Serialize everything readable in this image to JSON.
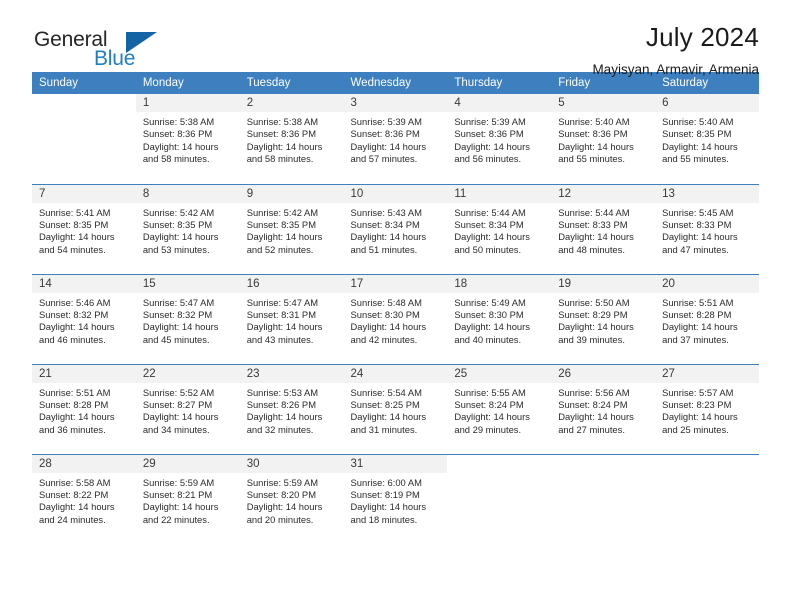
{
  "brand": {
    "name_top": "General",
    "name_bottom": "Blue",
    "triangle_color": "#1464a5",
    "blue_color": "#1f7fc4"
  },
  "header": {
    "title": "July 2024",
    "subtitle": "Mayisyan, Armavir, Armenia",
    "header_bg": "#3d7fbf"
  },
  "weekdays": [
    "Sunday",
    "Monday",
    "Tuesday",
    "Wednesday",
    "Thursday",
    "Friday",
    "Saturday"
  ],
  "weeks": [
    [
      {
        "day": ""
      },
      {
        "day": "1",
        "sunrise": "Sunrise: 5:38 AM",
        "sunset": "Sunset: 8:36 PM",
        "daylight1": "Daylight: 14 hours",
        "daylight2": "and 58 minutes."
      },
      {
        "day": "2",
        "sunrise": "Sunrise: 5:38 AM",
        "sunset": "Sunset: 8:36 PM",
        "daylight1": "Daylight: 14 hours",
        "daylight2": "and 58 minutes."
      },
      {
        "day": "3",
        "sunrise": "Sunrise: 5:39 AM",
        "sunset": "Sunset: 8:36 PM",
        "daylight1": "Daylight: 14 hours",
        "daylight2": "and 57 minutes."
      },
      {
        "day": "4",
        "sunrise": "Sunrise: 5:39 AM",
        "sunset": "Sunset: 8:36 PM",
        "daylight1": "Daylight: 14 hours",
        "daylight2": "and 56 minutes."
      },
      {
        "day": "5",
        "sunrise": "Sunrise: 5:40 AM",
        "sunset": "Sunset: 8:36 PM",
        "daylight1": "Daylight: 14 hours",
        "daylight2": "and 55 minutes."
      },
      {
        "day": "6",
        "sunrise": "Sunrise: 5:40 AM",
        "sunset": "Sunset: 8:35 PM",
        "daylight1": "Daylight: 14 hours",
        "daylight2": "and 55 minutes."
      }
    ],
    [
      {
        "day": "7",
        "sunrise": "Sunrise: 5:41 AM",
        "sunset": "Sunset: 8:35 PM",
        "daylight1": "Daylight: 14 hours",
        "daylight2": "and 54 minutes."
      },
      {
        "day": "8",
        "sunrise": "Sunrise: 5:42 AM",
        "sunset": "Sunset: 8:35 PM",
        "daylight1": "Daylight: 14 hours",
        "daylight2": "and 53 minutes."
      },
      {
        "day": "9",
        "sunrise": "Sunrise: 5:42 AM",
        "sunset": "Sunset: 8:35 PM",
        "daylight1": "Daylight: 14 hours",
        "daylight2": "and 52 minutes."
      },
      {
        "day": "10",
        "sunrise": "Sunrise: 5:43 AM",
        "sunset": "Sunset: 8:34 PM",
        "daylight1": "Daylight: 14 hours",
        "daylight2": "and 51 minutes."
      },
      {
        "day": "11",
        "sunrise": "Sunrise: 5:44 AM",
        "sunset": "Sunset: 8:34 PM",
        "daylight1": "Daylight: 14 hours",
        "daylight2": "and 50 minutes."
      },
      {
        "day": "12",
        "sunrise": "Sunrise: 5:44 AM",
        "sunset": "Sunset: 8:33 PM",
        "daylight1": "Daylight: 14 hours",
        "daylight2": "and 48 minutes."
      },
      {
        "day": "13",
        "sunrise": "Sunrise: 5:45 AM",
        "sunset": "Sunset: 8:33 PM",
        "daylight1": "Daylight: 14 hours",
        "daylight2": "and 47 minutes."
      }
    ],
    [
      {
        "day": "14",
        "sunrise": "Sunrise: 5:46 AM",
        "sunset": "Sunset: 8:32 PM",
        "daylight1": "Daylight: 14 hours",
        "daylight2": "and 46 minutes."
      },
      {
        "day": "15",
        "sunrise": "Sunrise: 5:47 AM",
        "sunset": "Sunset: 8:32 PM",
        "daylight1": "Daylight: 14 hours",
        "daylight2": "and 45 minutes."
      },
      {
        "day": "16",
        "sunrise": "Sunrise: 5:47 AM",
        "sunset": "Sunset: 8:31 PM",
        "daylight1": "Daylight: 14 hours",
        "daylight2": "and 43 minutes."
      },
      {
        "day": "17",
        "sunrise": "Sunrise: 5:48 AM",
        "sunset": "Sunset: 8:30 PM",
        "daylight1": "Daylight: 14 hours",
        "daylight2": "and 42 minutes."
      },
      {
        "day": "18",
        "sunrise": "Sunrise: 5:49 AM",
        "sunset": "Sunset: 8:30 PM",
        "daylight1": "Daylight: 14 hours",
        "daylight2": "and 40 minutes."
      },
      {
        "day": "19",
        "sunrise": "Sunrise: 5:50 AM",
        "sunset": "Sunset: 8:29 PM",
        "daylight1": "Daylight: 14 hours",
        "daylight2": "and 39 minutes."
      },
      {
        "day": "20",
        "sunrise": "Sunrise: 5:51 AM",
        "sunset": "Sunset: 8:28 PM",
        "daylight1": "Daylight: 14 hours",
        "daylight2": "and 37 minutes."
      }
    ],
    [
      {
        "day": "21",
        "sunrise": "Sunrise: 5:51 AM",
        "sunset": "Sunset: 8:28 PM",
        "daylight1": "Daylight: 14 hours",
        "daylight2": "and 36 minutes."
      },
      {
        "day": "22",
        "sunrise": "Sunrise: 5:52 AM",
        "sunset": "Sunset: 8:27 PM",
        "daylight1": "Daylight: 14 hours",
        "daylight2": "and 34 minutes."
      },
      {
        "day": "23",
        "sunrise": "Sunrise: 5:53 AM",
        "sunset": "Sunset: 8:26 PM",
        "daylight1": "Daylight: 14 hours",
        "daylight2": "and 32 minutes."
      },
      {
        "day": "24",
        "sunrise": "Sunrise: 5:54 AM",
        "sunset": "Sunset: 8:25 PM",
        "daylight1": "Daylight: 14 hours",
        "daylight2": "and 31 minutes."
      },
      {
        "day": "25",
        "sunrise": "Sunrise: 5:55 AM",
        "sunset": "Sunset: 8:24 PM",
        "daylight1": "Daylight: 14 hours",
        "daylight2": "and 29 minutes."
      },
      {
        "day": "26",
        "sunrise": "Sunrise: 5:56 AM",
        "sunset": "Sunset: 8:24 PM",
        "daylight1": "Daylight: 14 hours",
        "daylight2": "and 27 minutes."
      },
      {
        "day": "27",
        "sunrise": "Sunrise: 5:57 AM",
        "sunset": "Sunset: 8:23 PM",
        "daylight1": "Daylight: 14 hours",
        "daylight2": "and 25 minutes."
      }
    ],
    [
      {
        "day": "28",
        "sunrise": "Sunrise: 5:58 AM",
        "sunset": "Sunset: 8:22 PM",
        "daylight1": "Daylight: 14 hours",
        "daylight2": "and 24 minutes."
      },
      {
        "day": "29",
        "sunrise": "Sunrise: 5:59 AM",
        "sunset": "Sunset: 8:21 PM",
        "daylight1": "Daylight: 14 hours",
        "daylight2": "and 22 minutes."
      },
      {
        "day": "30",
        "sunrise": "Sunrise: 5:59 AM",
        "sunset": "Sunset: 8:20 PM",
        "daylight1": "Daylight: 14 hours",
        "daylight2": "and 20 minutes."
      },
      {
        "day": "31",
        "sunrise": "Sunrise: 6:00 AM",
        "sunset": "Sunset: 8:19 PM",
        "daylight1": "Daylight: 14 hours",
        "daylight2": "and 18 minutes."
      },
      {
        "day": ""
      },
      {
        "day": ""
      },
      {
        "day": ""
      }
    ]
  ]
}
